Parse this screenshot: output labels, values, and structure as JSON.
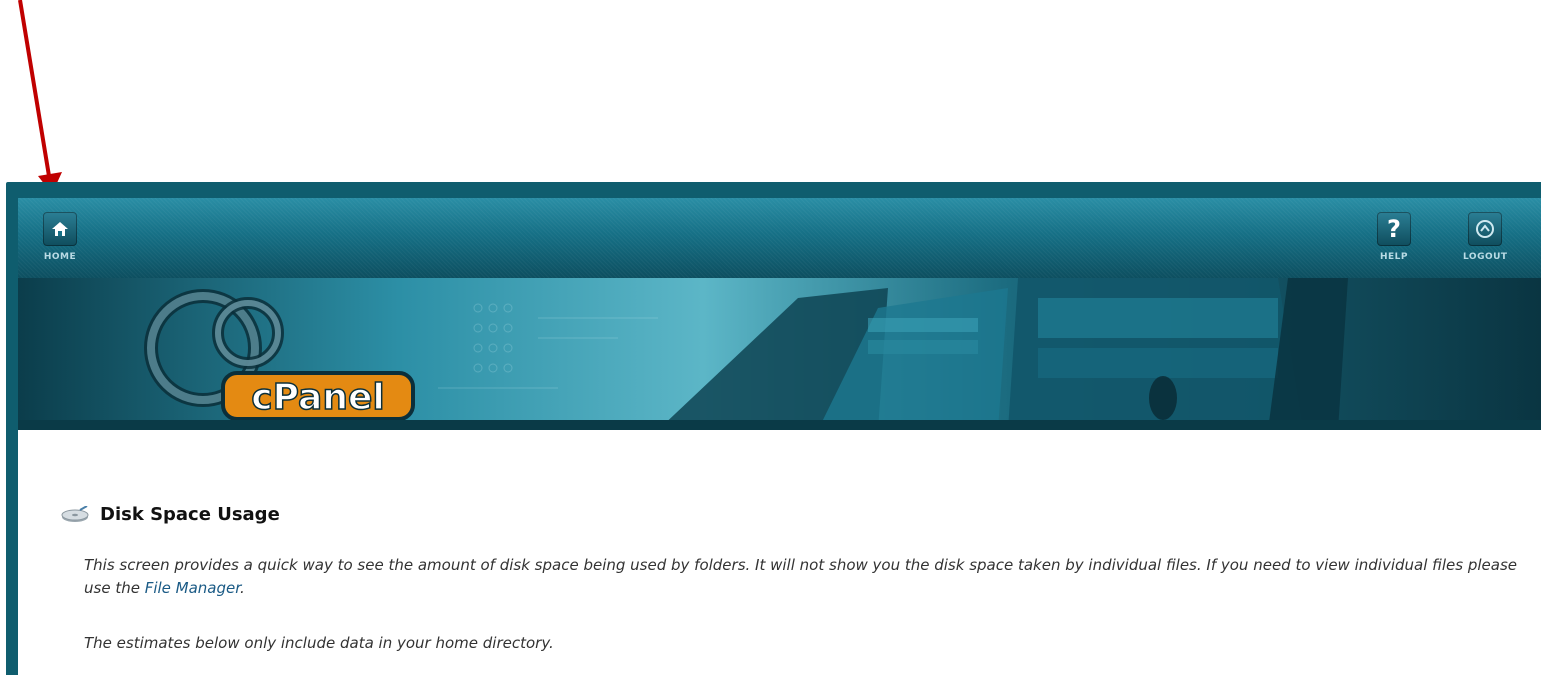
{
  "nav": {
    "home_label": "HOME",
    "help_label": "HELP",
    "logout_label": "LOGOUT",
    "help_glyph": "?"
  },
  "banner": {
    "logo_text": "cPanel"
  },
  "page": {
    "title": "Disk Space Usage",
    "description_part1": "This screen provides a quick way to see the amount of disk space being used by folders. It will not show you the disk space taken by individual files. If you need to view individual files please use the ",
    "file_manager_link": "File Manager",
    "description_part2": ".",
    "estimate_note": "The estimates below only include data in your home directory."
  },
  "icons": {
    "home": "home-icon",
    "help": "help-icon",
    "logout": "logout-icon",
    "disk": "disk-icon",
    "annotation": "arrow-annotation"
  },
  "colors": {
    "frame": "#0f5d6e",
    "annotation_arrow": "#c00000",
    "link": "#1a5a85"
  }
}
